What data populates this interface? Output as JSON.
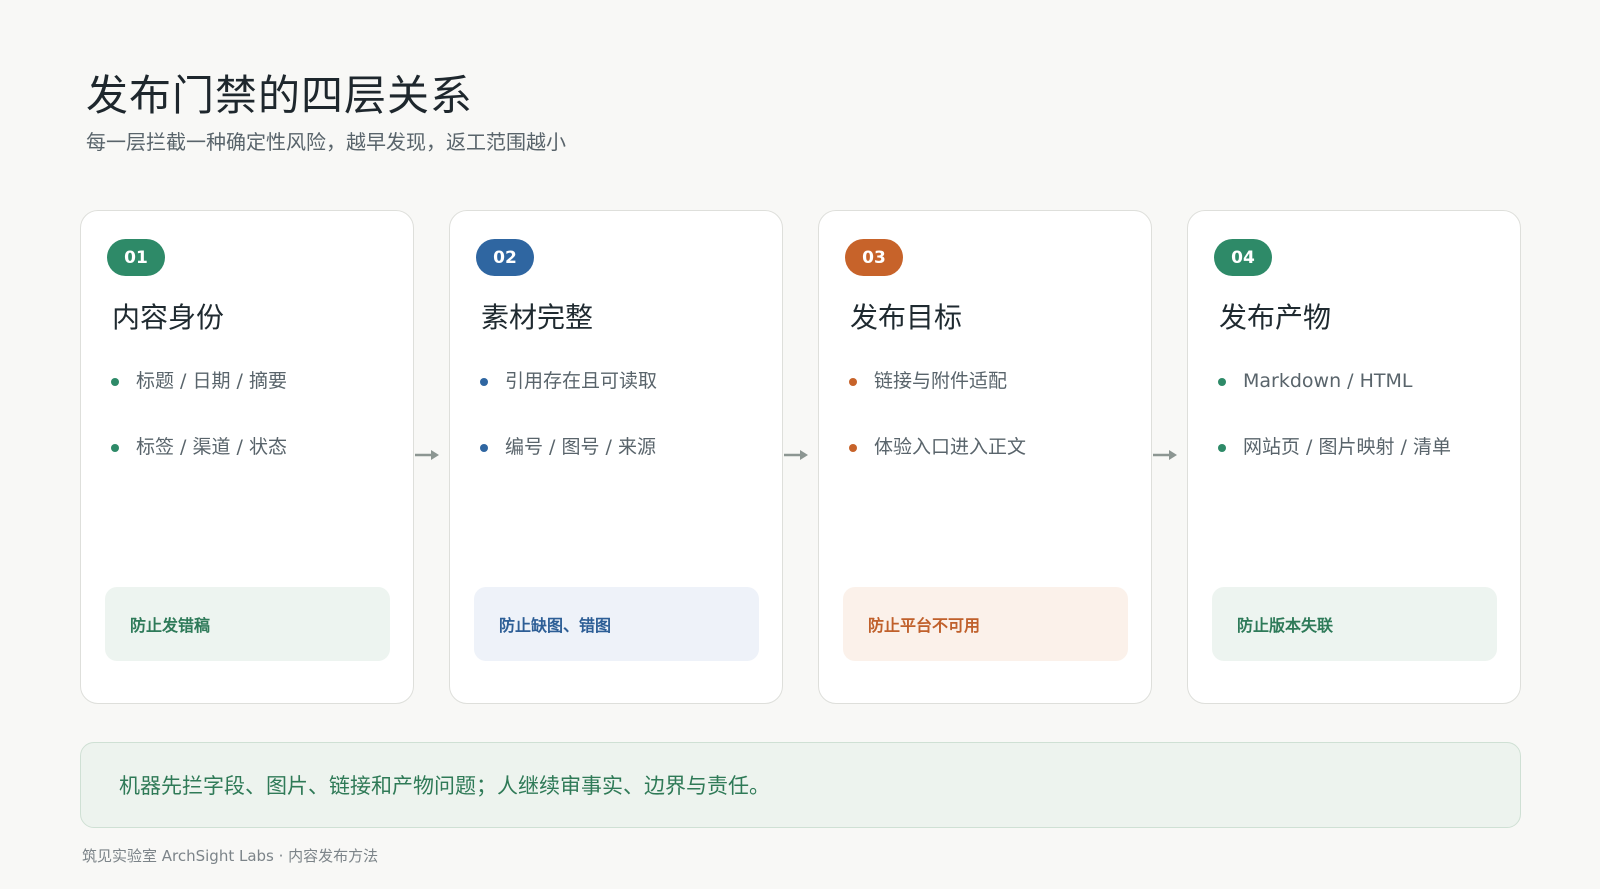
{
  "title": "发布门禁的四层关系",
  "subtitle": "每一层拦截一种确定性风险，越早发现，返工范围越小",
  "cards": [
    {
      "number": "01",
      "title": "内容身份",
      "bullets": [
        "标题 / 日期 / 摘要",
        "标签 / 渠道 / 状态"
      ],
      "tag": "防止发错稿",
      "accent": "#2e8a68",
      "tag_bg": "#edf4f0",
      "tag_color": "#2e7a59"
    },
    {
      "number": "02",
      "title": "素材完整",
      "bullets": [
        "引用存在且可读取",
        "编号 / 图号 / 来源"
      ],
      "tag": "防止缺图、错图",
      "accent": "#2f66a1",
      "tag_bg": "#eef2f9",
      "tag_color": "#2d5e96"
    },
    {
      "number": "03",
      "title": "发布目标",
      "bullets": [
        "链接与附件适配",
        "体验入口进入正文"
      ],
      "tag": "防止平台不可用",
      "accent": "#c7632a",
      "tag_bg": "#fbf1ea",
      "tag_color": "#c0602b"
    },
    {
      "number": "04",
      "title": "发布产物",
      "bullets": [
        "Markdown / HTML",
        "网站页 / 图片映射 / 清单"
      ],
      "tag": "防止版本失联",
      "accent": "#2e8a68",
      "tag_bg": "#edf4f0",
      "tag_color": "#2e7a59"
    }
  ],
  "summary": "机器先拦字段、图片、链接和产物问题；人继续审事实、边界与责任。",
  "footer": "筑见实验室 ArchSight Labs · 内容发布方法",
  "colors": {
    "arrow": "#8c9692",
    "summary_bg": "#edf3ee",
    "summary_text": "#2f7a57"
  }
}
